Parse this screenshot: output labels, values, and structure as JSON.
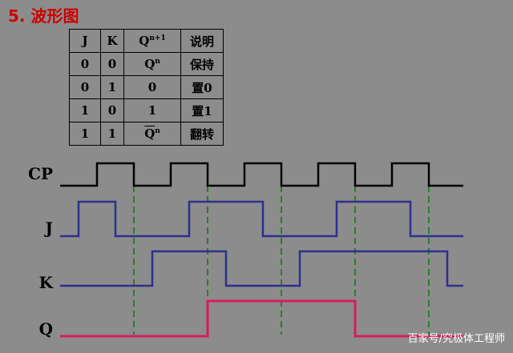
{
  "title": "5. 波形图",
  "table": {
    "headers": [
      "J",
      "K",
      "Q",
      "说明"
    ],
    "header_sup": "n+1",
    "rows": [
      {
        "j": "0",
        "k": "0",
        "q": "Q",
        "q_sup": "n",
        "desc": "保持"
      },
      {
        "j": "0",
        "k": "1",
        "q": "0",
        "q_sup": "",
        "desc": "置0"
      },
      {
        "j": "1",
        "k": "0",
        "q": "1",
        "q_sup": "",
        "desc": "置1"
      },
      {
        "j": "1",
        "k": "1",
        "q": "Q",
        "q_sup": "n",
        "q_overline": true,
        "desc": "翻转"
      }
    ]
  },
  "signals": [
    {
      "name": "CP",
      "color": "#000000",
      "transitions": [
        [
          0,
          0
        ],
        [
          1,
          1
        ],
        [
          2,
          0
        ],
        [
          3,
          1
        ],
        [
          4,
          0
        ],
        [
          5,
          1
        ],
        [
          6,
          0
        ],
        [
          7,
          1
        ],
        [
          8,
          0
        ],
        [
          9,
          1
        ],
        [
          10,
          0
        ]
      ]
    },
    {
      "name": "J",
      "color": "#2e2e8e",
      "transitions": [
        [
          0,
          0
        ],
        [
          0.5,
          1
        ],
        [
          1.5,
          0
        ],
        [
          3.5,
          1
        ],
        [
          5.5,
          0
        ],
        [
          7.5,
          1
        ],
        [
          9.5,
          0
        ]
      ]
    },
    {
      "name": "K",
      "color": "#2e2e8e",
      "transitions": [
        [
          0,
          0
        ],
        [
          2.5,
          1
        ],
        [
          4.5,
          0
        ],
        [
          6.5,
          1
        ],
        [
          10.5,
          0
        ]
      ]
    },
    {
      "name": "Q",
      "color": "#d81b60",
      "transitions": [
        [
          0,
          0
        ],
        [
          4,
          1
        ],
        [
          8,
          0
        ]
      ]
    }
  ],
  "markers": [
    2,
    4,
    6,
    8,
    10
  ],
  "marker_color": "#008000",
  "watermark": "百家号/究极体工程师"
}
